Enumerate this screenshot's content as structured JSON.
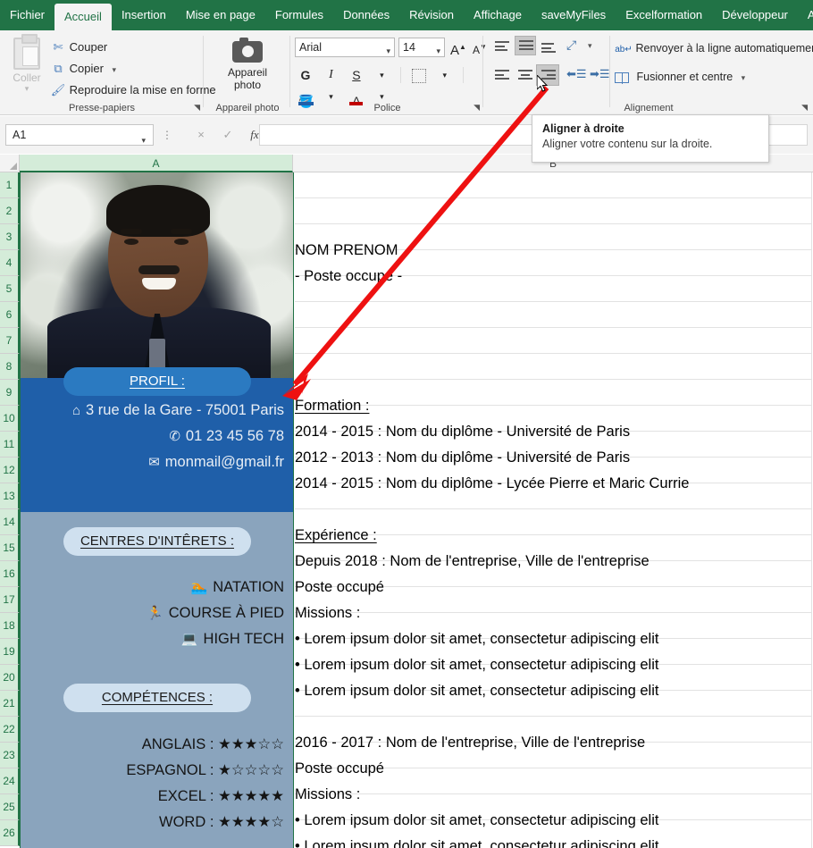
{
  "ribbon": {
    "tabs": [
      {
        "label": "Fichier",
        "active": false
      },
      {
        "label": "Accueil",
        "active": true
      },
      {
        "label": "Insertion",
        "active": false
      },
      {
        "label": "Mise en page",
        "active": false
      },
      {
        "label": "Formules",
        "active": false
      },
      {
        "label": "Données",
        "active": false
      },
      {
        "label": "Révision",
        "active": false
      },
      {
        "label": "Affichage",
        "active": false
      },
      {
        "label": "saveMyFiles",
        "active": false
      },
      {
        "label": "Excelformation",
        "active": false
      },
      {
        "label": "Développeur",
        "active": false
      },
      {
        "label": "Ai",
        "active": false
      }
    ],
    "clipboard": {
      "group_label": "Presse-papiers",
      "paste_label": "Coller",
      "cut_label": "Couper",
      "copy_label": "Copier",
      "format_painter_label": "Reproduire la mise en forme"
    },
    "camera": {
      "group_label": "Appareil photo",
      "button_label_line1": "Appareil",
      "button_label_line2": "photo"
    },
    "font": {
      "group_label": "Police",
      "font_name": "Arial",
      "font_size": "14",
      "bold_label": "G",
      "italic_label": "I",
      "underline_label": "S",
      "grow_label": "A",
      "shrink_label": "A",
      "fontcolor_label": "A"
    },
    "alignment": {
      "group_label": "Alignement",
      "wrap_text_label": "Renvoyer à la ligne automatiquement",
      "merge_center_label": "Fusionner et centre"
    }
  },
  "tooltip": {
    "title": "Aligner à droite",
    "description": "Aligner votre contenu sur la droite."
  },
  "formula_bar": {
    "name_box": "A1",
    "cancel_icon": "×",
    "confirm_icon": "✓",
    "function_icon": "fx",
    "formula_value": ""
  },
  "grid": {
    "columns": [
      {
        "label": "A",
        "selected": true
      },
      {
        "label": "B",
        "selected": false
      }
    ],
    "rows": [
      "1",
      "2",
      "3",
      "4",
      "5",
      "6",
      "7",
      "8",
      "9",
      "10",
      "11",
      "12",
      "13",
      "14",
      "15",
      "16",
      "17",
      "18",
      "19",
      "20",
      "21",
      "22",
      "23",
      "24",
      "25",
      "26"
    ]
  },
  "cv": {
    "profil_title": "PROFIL :",
    "address": "3 rue de la Gare - 75001 Paris",
    "phone": "01 23 45 56 78",
    "email": "monmail@gmail.fr",
    "address_icon": "⌂",
    "phone_icon": "✆",
    "email_icon": "✉",
    "interests_title": "CENTRES D'INTÊRETS :",
    "interests": [
      {
        "icon": "🏊",
        "label": "NATATION"
      },
      {
        "icon": "🏃",
        "label": "COURSE À PIED"
      },
      {
        "icon": "💻",
        "label": "HIGH TECH"
      }
    ],
    "skills_title": "COMPÉTENCES :",
    "skills": [
      {
        "label": "ANGLAIS :",
        "stars": "★★★☆☆",
        "rating": 3
      },
      {
        "label": "ESPAGNOL :",
        "stars": "★☆☆☆☆",
        "rating": 1
      },
      {
        "label": "EXCEL :",
        "stars": "★★★★★",
        "rating": 5
      },
      {
        "label": "WORD :",
        "stars": "★★★★☆",
        "rating": 4
      }
    ],
    "name": "NOM PRENOM",
    "job_title": "- Poste occupé -",
    "formation_title": "Formation :",
    "formation": [
      "2014 - 2015 : Nom du diplôme  - Université de Paris",
      "2012 - 2013 : Nom du diplôme - Université de Paris",
      "2014 - 2015 : Nom du diplôme - Lycée Pierre et Maric Currie"
    ],
    "experience_title": "Expérience :",
    "experience": [
      {
        "period": "Depuis 2018 : Nom de l'entreprise, Ville de l'entreprise",
        "role": "Poste occupé",
        "missions_label": "Missions :",
        "missions": [
          "• Lorem ipsum dolor sit amet, consectetur adipiscing elit",
          "• Lorem ipsum dolor sit amet, consectetur adipiscing elit",
          "• Lorem ipsum dolor sit amet, consectetur adipiscing elit"
        ]
      },
      {
        "period": "2016 - 2017 : Nom de l'entreprise, Ville de l'entreprise",
        "role": "Poste occupé",
        "missions_label": "Missions :",
        "missions": [
          "• Lorem ipsum dolor sit amet, consectetur adipiscing elit",
          "• Lorem ipsum dolor sit amet, consectetur adipiscing elit"
        ]
      }
    ]
  },
  "colors": {
    "ribbon_green": "#217346",
    "panel_dark_blue": "#1f5fa9",
    "panel_light_blue": "#8aa4bd",
    "pill_blue": "#2b7ac1",
    "pill_light": "#cfe0ef",
    "arrow_red": "#ee1111"
  }
}
